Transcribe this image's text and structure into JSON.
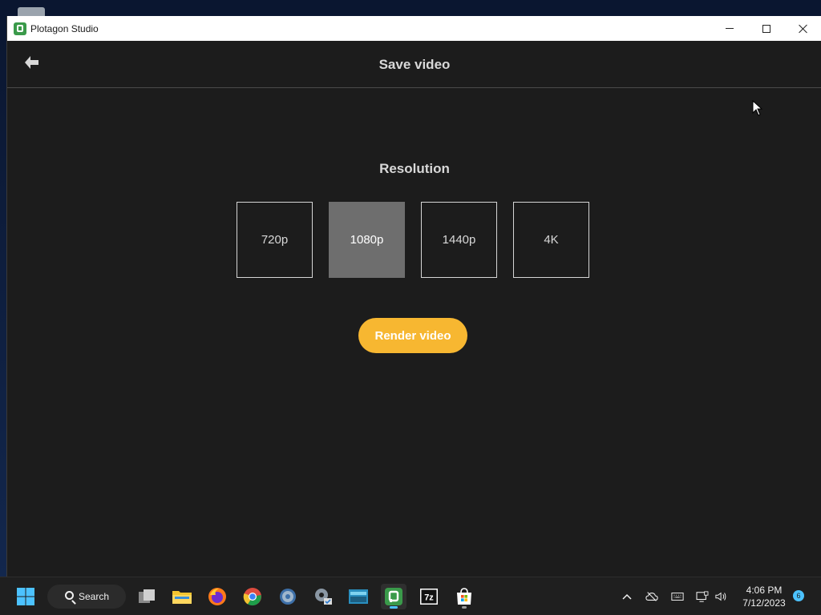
{
  "window": {
    "title": "Plotagon Studio"
  },
  "header": {
    "title": "Save video"
  },
  "resolution": {
    "title": "Resolution",
    "options": [
      "720p",
      "1080p",
      "1440p",
      "4K"
    ],
    "selected": "1080p"
  },
  "render_button": {
    "label": "Render video"
  },
  "taskbar": {
    "search_label": "Search",
    "time": "4:06 PM",
    "date": "7/12/2023",
    "notification_count": "6"
  },
  "colors": {
    "accent": "#f7b731",
    "selected_option": "#6e6e6e",
    "window_background": "#1c1c1c"
  },
  "icons": {
    "back": "arrow-left-icon",
    "app": "plotagon-icon"
  }
}
